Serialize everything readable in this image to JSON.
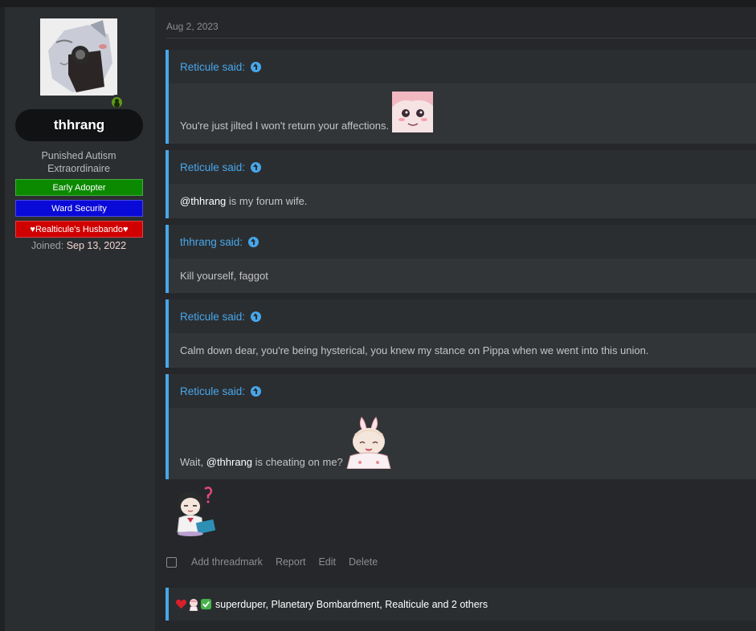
{
  "user": {
    "name": "thhrang",
    "title_line1": "Punished Autism",
    "title_line2": "Extraordinaire",
    "banners": [
      "Early Adopter",
      "Ward Security",
      "♥Realticule's Husbando♥"
    ],
    "joined_label": "Joined:",
    "joined_date": "Sep 13, 2022",
    "online": true
  },
  "post": {
    "date": "Aug 2, 2023",
    "quotes": [
      {
        "author": "Reticule said:",
        "text": "You're just jilted I won't return your affections."
      },
      {
        "author": "Reticule said:",
        "mention": "@thhrang",
        "text": " is my forum wife."
      },
      {
        "author": "thhrang said:",
        "text": "Kill yourself, faggot"
      },
      {
        "author": "Reticule said:",
        "text": "Calm down dear, you're being hysterical, you knew my stance on Pippa when we went into this union."
      },
      {
        "author": "Reticule said:",
        "text_before": "Wait, ",
        "mention": "@thhrang",
        "text_after": " is cheating on me?"
      }
    ]
  },
  "actions": {
    "threadmark": "Add threadmark",
    "report": "Report",
    "edit": "Edit",
    "delete": "Delete"
  },
  "reactions": {
    "icons": [
      "heart-icon",
      "anime-sticker-icon",
      "checkmark-icon"
    ],
    "text": "superduper, Planetary Bombardment, Realticule and 2 others"
  },
  "colors": {
    "accent": "#47a7eb",
    "early_adopter": "#0b8a00",
    "ward_security": "#0a0ad8",
    "husbando": "#d00000",
    "online": "#5f9b1a"
  }
}
